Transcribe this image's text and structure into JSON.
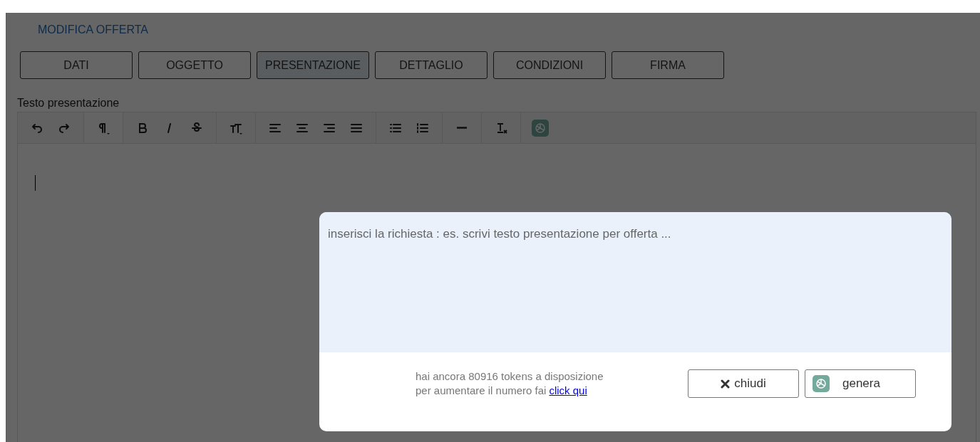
{
  "page": {
    "title": "MODIFICA OFFERTA"
  },
  "tabs": [
    {
      "label": "DATI",
      "selected": false
    },
    {
      "label": "OGGETTO",
      "selected": false
    },
    {
      "label": "PRESENTAZIONE",
      "selected": true
    },
    {
      "label": "DETTAGLIO",
      "selected": false
    },
    {
      "label": "CONDIZIONI",
      "selected": false
    },
    {
      "label": "FIRMA",
      "selected": false
    }
  ],
  "editor": {
    "label": "Testo presentazione"
  },
  "dialog": {
    "request_field": {
      "placeholder": "inserisci la richiesta : es. scrivi testo presentazione per offerta ..."
    },
    "tokens_text": "hai ancora 80916 tokens a disposizione",
    "increase_text": "per aumentare il numero fai",
    "link": "click qui",
    "buttons": [
      {
        "kind": "close",
        "label": "chiudi"
      },
      {
        "kind": "generate",
        "label": "genera"
      }
    ]
  }
}
